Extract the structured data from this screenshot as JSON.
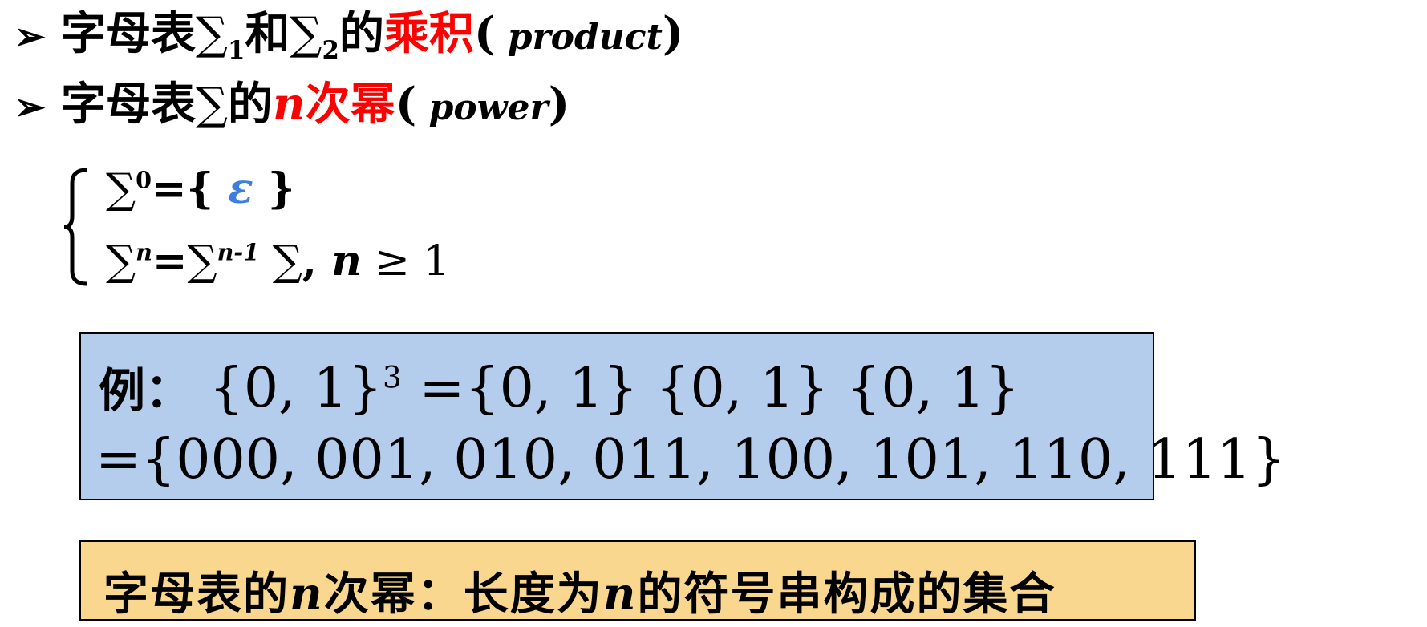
{
  "bullet1": {
    "arrow": "➢",
    "prefix": "字母表",
    "sigma": "∑",
    "sub1": "1",
    "and": "和",
    "sub2": "2",
    "of": "的",
    "highlight": "乘积",
    "paren_open": "(",
    "english": " product",
    "paren_close": ")"
  },
  "bullet2": {
    "arrow": "➢",
    "prefix": "字母表",
    "sigma": "∑",
    "of": "的",
    "n": "n",
    "highlight": "次幂",
    "paren_open": "(",
    "english": " power",
    "paren_close": ")"
  },
  "definition": {
    "line1": {
      "sigma": "∑",
      "sup": "0",
      "eq": "=",
      "open": "{ ",
      "epsilon": "ε",
      "close": " }"
    },
    "line2": {
      "sigma": "∑",
      "sup": "n",
      "eq": "=",
      "sigma2": "∑",
      "sup2": "n-1",
      "sigma3": " ∑",
      "comma": ", ",
      "n": "n",
      "geq": " ≥ 1"
    }
  },
  "example": {
    "label": "例：",
    "lhs": "{0, 1}",
    "exp": "3",
    "rhs": " ={0, 1} {0, 1} {0, 1}",
    "line2": "={000, 001, 010, 011, 100, 101, 110, 111}"
  },
  "summary": {
    "part1": "字母表的",
    "n1": "n",
    "part2": "次幂：长度为",
    "n2": "n",
    "part3": "的符号串构成的集合"
  },
  "colors": {
    "highlight": "#ff0000",
    "epsilon": "#3d7fe0",
    "example_bg": "#b4cdec",
    "summary_bg": "#f9d78f"
  }
}
